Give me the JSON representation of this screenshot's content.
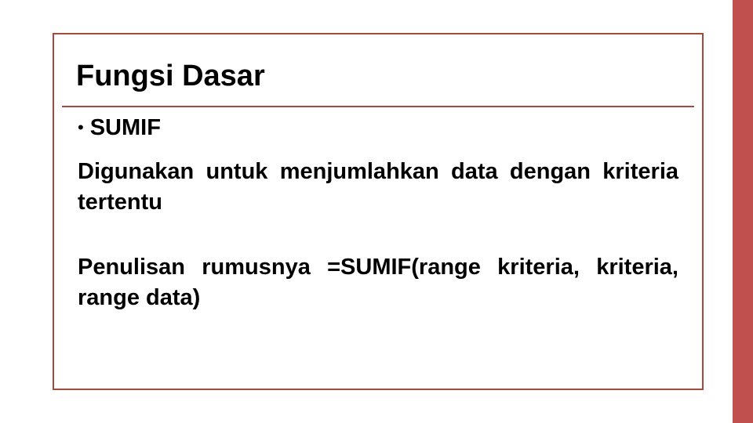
{
  "slide": {
    "title": "Fungsi Dasar",
    "bullet_label": "SUMIF",
    "description": "Digunakan untuk menjumlahkan data dengan kriteria tertentu",
    "formula": "Penulisan rumusnya =SUMIF(range kriteria, kriteria, range data)"
  },
  "colors": {
    "accent": "#c0504d",
    "border": "#a24a3f"
  }
}
